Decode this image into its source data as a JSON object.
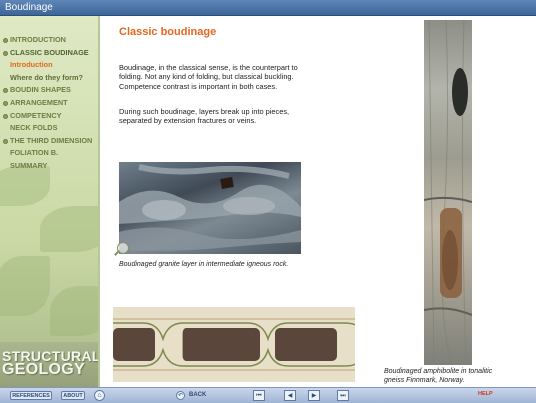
{
  "window": {
    "title": "Boudinage"
  },
  "sidebar": {
    "items": [
      {
        "label": "INTRODUCTION",
        "style": "dot"
      },
      {
        "label": "CLASSIC BOUDINAGE",
        "style": "dot-current"
      },
      {
        "label": "Introduction",
        "style": "sub"
      },
      {
        "label": "Where do they form?",
        "style": "subplain"
      },
      {
        "label": "BOUDIN SHAPES",
        "style": "dot"
      },
      {
        "label": "ARRANGEMENT",
        "style": "dot"
      },
      {
        "label": "COMPETENCY",
        "style": "dot"
      },
      {
        "label": "NECK FOLDS",
        "style": "plain"
      },
      {
        "label": "THE THIRD DIMENSION",
        "style": "dot"
      },
      {
        "label": "FOLIATION B.",
        "style": "plain"
      },
      {
        "label": "SUMMARY",
        "style": "plain"
      }
    ],
    "brand_line1": "STRUCTURAL",
    "brand_line2": "GEOLOGY"
  },
  "content": {
    "title": "Classic boudinage",
    "paragraph1": "Boudinage, in the classical sense, is the counterpart to folding. Not any kind of folding, but classical buckling. Competence contrast is important in both cases.",
    "paragraph2": "During such boudinage, layers break up into pieces, separated by extension fractures or veins.",
    "caption1": "Boudinaged granite layer in intermediate igneous rock.",
    "caption2": "Boudinaged amphibolite in tonalitic gneiss Finnmark, Norway."
  },
  "bottombar": {
    "references": "REFERENCES",
    "about": "ABOUT",
    "back": "BACK",
    "help": "HELP"
  },
  "colors": {
    "accent": "#e4661f",
    "sidebar_text": "#6c7d43",
    "titlebar": "#4a72a6"
  },
  "icons": [
    "home-icon",
    "back-icon",
    "first-page-icon",
    "previous-page-icon",
    "play-icon",
    "last-page-icon",
    "zoom-icon"
  ]
}
